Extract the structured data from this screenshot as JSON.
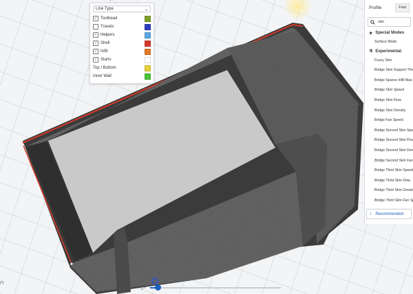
{
  "line_type": {
    "dropdown_label": "Line Type",
    "rows": [
      {
        "label": "Toolhead",
        "checked": true,
        "color": "#7ea02c"
      },
      {
        "label": "Travels",
        "checked": false,
        "color": "#2f3fbf"
      },
      {
        "label": "Helpers",
        "checked": true,
        "color": "#5aa7e0"
      },
      {
        "label": "Shell",
        "checked": true,
        "color": "#d63a2a"
      },
      {
        "label": "Infill",
        "checked": true,
        "color": "#e07a2a"
      },
      {
        "label": "Starts",
        "checked": true,
        "color": "#ffffff"
      },
      {
        "label": "Top / Bottom",
        "checked": null,
        "color": "#e8d23a"
      },
      {
        "label": "Inner Wall",
        "checked": null,
        "color": "#4cc23a"
      }
    ]
  },
  "settings": {
    "profile_label": "Profile",
    "profile_value": "Fast",
    "search_value": "skin",
    "special_modes": "Special Modes",
    "surface_mode": "Surface Mode",
    "experimental": "Experimental",
    "items": [
      {
        "label": "Fuzzy Skin",
        "italic": false
      },
      {
        "label": "Bridge Skin Support Threshold",
        "italic": false
      },
      {
        "label": "Bridge Sparse Infill Max Density",
        "italic": false
      },
      {
        "label": "Bridge Skin Speed",
        "italic": true
      },
      {
        "label": "Bridge Skin Flow",
        "italic": false
      },
      {
        "label": "Bridge Skin Density",
        "italic": false
      },
      {
        "label": "Bridge Fan Speed",
        "italic": false
      },
      {
        "label": "Bridge Second Skin Speed",
        "italic": false
      },
      {
        "label": "Bridge Second Skin Flow",
        "italic": false
      },
      {
        "label": "Bridge Second Skin Density",
        "italic": false
      },
      {
        "label": "Bridge Second Skin Fan Speed",
        "italic": true
      },
      {
        "label": "Bridge Third Skin Speed",
        "italic": false
      },
      {
        "label": "Bridge Third Skin Flow",
        "italic": true
      },
      {
        "label": "Bridge Third Skin Density",
        "italic": false
      },
      {
        "label": "Bridge Third Skin Fan Speed",
        "italic": true
      }
    ],
    "recommended_label": "Recommended"
  },
  "colors": {
    "model_outer": "#3a3a3a",
    "model_wall": "#5a5a5a",
    "model_floor": "#c9c9c9",
    "shell": "#d63a2a",
    "accent": "#1a5fbf"
  }
}
